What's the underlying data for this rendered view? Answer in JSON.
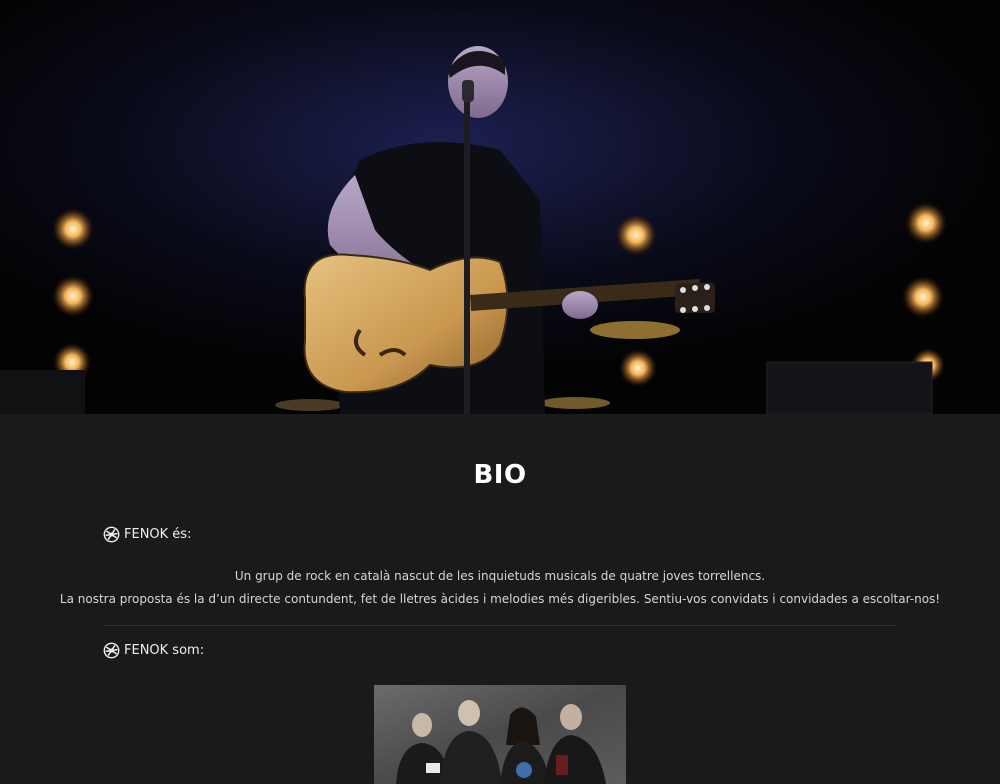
{
  "hero": {
    "image": "performer-on-stage-photo"
  },
  "bio": {
    "title": "BIO",
    "section1": {
      "heading": "FENOK és:",
      "icon": "fenok-logo-icon",
      "paragraphs": [
        "Un grup de rock en català nascut de les inquietuds musicals de quatre joves torrellencs.",
        "La nostra proposta és la d’un directe contundent, fet de lletres àcides i melodies més digeribles. Sentiu-vos convidats i convidades a escoltar-nos!"
      ]
    },
    "section2": {
      "heading": "FENOK som:",
      "icon": "fenok-logo-icon",
      "image": "band-members-photo"
    }
  },
  "colors": {
    "background": "#1a1a1a",
    "hero_background": "#050505",
    "text": "#e8e8e8"
  }
}
